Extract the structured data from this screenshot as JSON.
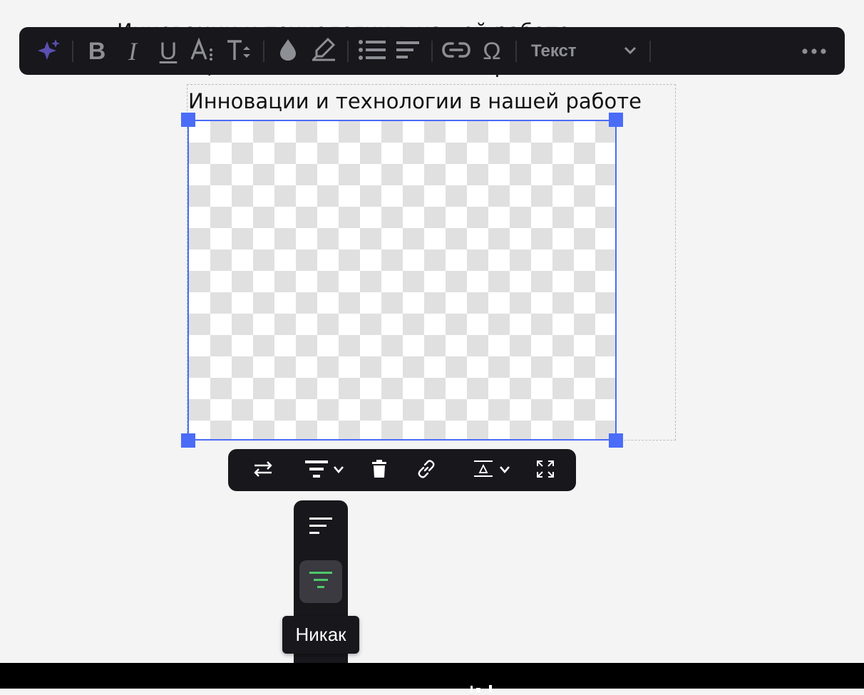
{
  "document": {
    "heading_line1": "Инновации и технологии в нашей работе",
    "heading_line2": "Инновации и технологии в нашей работе"
  },
  "format_toolbar": {
    "style_select": {
      "selected": "Текст"
    },
    "icons": [
      "ai-sparkle-icon",
      "bold-icon",
      "italic-icon",
      "underline-icon",
      "font-size-icon",
      "text-height-icon",
      "text-color-icon",
      "highlight-icon",
      "bulleted-list-icon",
      "text-align-icon",
      "link-icon",
      "special-character-icon",
      "chevron-down-icon",
      "more-options-icon"
    ]
  },
  "image_block": {
    "caption": "Инновации и технологии в нашей работе",
    "selection_color": "#4a6cf7"
  },
  "image_toolbar": {
    "icons": [
      "replace-icon",
      "alignment-icon",
      "chevron-down-icon",
      "delete-icon",
      "link-icon",
      "caption-icon",
      "chevron-down-icon",
      "fullscreen-icon"
    ]
  },
  "alignment_menu": {
    "options": [
      {
        "name": "align-left",
        "active": false
      },
      {
        "name": "align-none",
        "active": true
      }
    ],
    "active_color": "#4fc96b"
  },
  "tooltip": {
    "text": "Никак"
  },
  "colors": {
    "toolbar_bg": "#17171c",
    "icon_muted": "#8e8e95",
    "ai_accent": "#5b4fb0",
    "selection": "#4a6cf7",
    "page_bg": "#f4f4f4"
  }
}
